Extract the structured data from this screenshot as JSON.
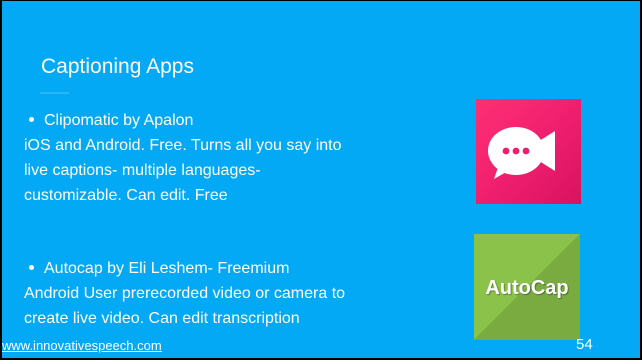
{
  "slide": {
    "background": "#03A9F4",
    "title": "Captioning Apps",
    "items": [
      {
        "bullet": "Clipomatic by Apalon",
        "lines": [
          "iOS and Android. Free. Turns all you say into",
          "live captions- multiple languages-",
          "customizable. Can edit. Free"
        ],
        "icon": "clipomatic-app-icon"
      },
      {
        "bullet": "Autocap by Eli Leshem- Freemium",
        "lines": [
          "Android User prerecorded video or camera to",
          "create live video. Can edit transcription"
        ],
        "icon": "autocap-app-icon",
        "icon_text": "AutoCap"
      }
    ],
    "footer_link": "www.innovativespeech.com",
    "page_number": "54"
  },
  "colors": {
    "clipomatic_bg": "#EE1E6E",
    "autocap_bg": "#8BC34A",
    "title_rule": "#29B6F6"
  }
}
